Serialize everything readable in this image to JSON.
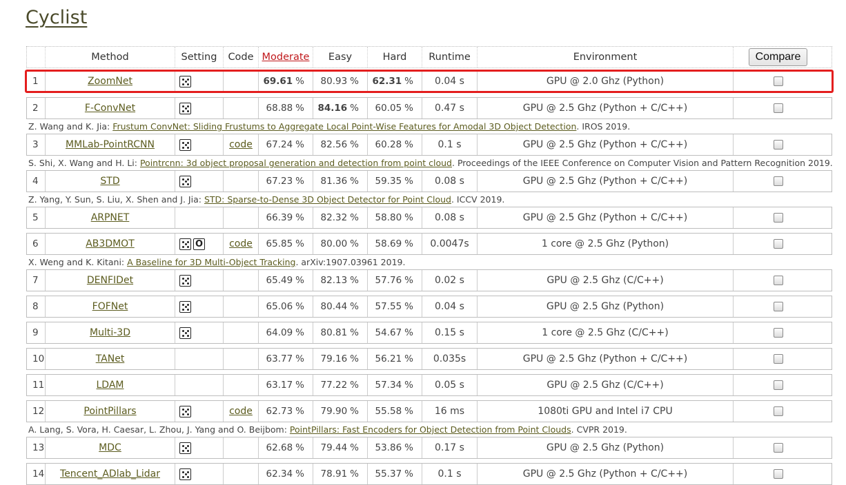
{
  "page": {
    "title": "Cyclist"
  },
  "header": {
    "rank": "",
    "method": "Method",
    "setting": "Setting",
    "code": "Code",
    "moderate": "Moderate",
    "easy": "Easy",
    "hard": "Hard",
    "runtime": "Runtime",
    "environment": "Environment",
    "compare_button": "Compare"
  },
  "rows": [
    {
      "rank": "1",
      "method": "ZoomNet",
      "icons": [
        "dice-icon"
      ],
      "code": "",
      "moderate": "69.61",
      "easy": "80.93",
      "hard": "62.31",
      "runtime": "0.04 s",
      "environment": "GPU @ 2.0 Ghz (Python)",
      "bold": [
        "moderate",
        "hard"
      ],
      "highlight": true,
      "paper": null
    },
    {
      "rank": "2",
      "method": "F-ConvNet",
      "icons": [
        "dice-icon"
      ],
      "code": "",
      "moderate": "68.88",
      "easy": "84.16",
      "hard": "60.05",
      "runtime": "0.47 s",
      "environment": "GPU @ 2.5 Ghz (Python + C/C++)",
      "bold": [
        "easy"
      ],
      "highlight": false,
      "paper": {
        "authors": "Z. Wang and K. Jia: ",
        "title": "Frustum ConvNet: Sliding Frustums to Aggregate Local Point-Wise Features for Amodal 3D Object Detection",
        "venue": ". IROS 2019."
      }
    },
    {
      "rank": "3",
      "method": "MMLab-PointRCNN",
      "icons": [
        "dice-icon"
      ],
      "code": "code",
      "moderate": "67.24",
      "easy": "82.56",
      "hard": "60.28",
      "runtime": "0.1 s",
      "environment": "GPU @ 2.5 Ghz (Python + C/C++)",
      "bold": [],
      "highlight": false,
      "paper": {
        "authors": "S. Shi, X. Wang and H. Li: ",
        "title": "Pointrcnn: 3d object proposal generation and detection from point cloud",
        "venue": ". Proceedings of the IEEE Conference on Computer Vision and Pattern Recognition 2019."
      }
    },
    {
      "rank": "4",
      "method": "STD",
      "icons": [
        "dice-icon"
      ],
      "code": "",
      "moderate": "67.23",
      "easy": "81.36",
      "hard": "59.35",
      "runtime": "0.08 s",
      "environment": "GPU @ 2.5 Ghz (Python + C/C++)",
      "bold": [],
      "highlight": false,
      "paper": {
        "authors": "Z. Yang, Y. Sun, S. Liu, X. Shen and J. Jia: ",
        "title": "STD: Sparse-to-Dense 3D Object Detector for Point Cloud",
        "venue": ". ICCV 2019."
      }
    },
    {
      "rank": "5",
      "method": "ARPNET",
      "icons": [],
      "code": "",
      "moderate": "66.39",
      "easy": "82.32",
      "hard": "58.80",
      "runtime": "0.08 s",
      "environment": "GPU @ 2.5 Ghz (Python + C/C++)",
      "bold": [],
      "highlight": false,
      "paper": null
    },
    {
      "rank": "6",
      "method": "AB3DMOT",
      "icons": [
        "dice-icon",
        "odometry-icon"
      ],
      "code": "code",
      "moderate": "65.85",
      "easy": "80.00",
      "hard": "58.69",
      "runtime": "0.0047s",
      "environment": "1 core @ 2.5 Ghz (Python)",
      "bold": [],
      "highlight": false,
      "paper": {
        "authors": "X. Weng and K. Kitani: ",
        "title": "A Baseline for 3D Multi-Object Tracking",
        "venue": ". arXiv:1907.03961 2019."
      }
    },
    {
      "rank": "7",
      "method": "DENFIDet",
      "icons": [
        "dice-icon"
      ],
      "code": "",
      "moderate": "65.49",
      "easy": "82.13",
      "hard": "57.76",
      "runtime": "0.02 s",
      "environment": "GPU @ 2.5 Ghz (C/C++)",
      "bold": [],
      "highlight": false,
      "paper": null
    },
    {
      "rank": "8",
      "method": "FOFNet",
      "icons": [
        "dice-icon"
      ],
      "code": "",
      "moderate": "65.06",
      "easy": "80.44",
      "hard": "57.55",
      "runtime": "0.04 s",
      "environment": "GPU @ 2.5 Ghz (Python)",
      "bold": [],
      "highlight": false,
      "paper": null
    },
    {
      "rank": "9",
      "method": "Multi-3D",
      "icons": [
        "dice-icon"
      ],
      "code": "",
      "moderate": "64.09",
      "easy": "80.81",
      "hard": "54.67",
      "runtime": "0.15 s",
      "environment": "1 core @ 2.5 Ghz (C/C++)",
      "bold": [],
      "highlight": false,
      "paper": null
    },
    {
      "rank": "10",
      "method": "TANet",
      "icons": [],
      "code": "",
      "moderate": "63.77",
      "easy": "79.16",
      "hard": "56.21",
      "runtime": "0.035s",
      "environment": "GPU @ 2.5 Ghz (Python + C/C++)",
      "bold": [],
      "highlight": false,
      "paper": null
    },
    {
      "rank": "11",
      "method": "LDAM",
      "icons": [],
      "code": "",
      "moderate": "63.17",
      "easy": "77.22",
      "hard": "57.34",
      "runtime": "0.05 s",
      "environment": "GPU @ 2.5 Ghz (C/C++)",
      "bold": [],
      "highlight": false,
      "paper": null
    },
    {
      "rank": "12",
      "method": "PointPillars",
      "icons": [
        "dice-icon"
      ],
      "code": "code",
      "moderate": "62.73",
      "easy": "79.90",
      "hard": "55.58",
      "runtime": "16 ms",
      "environment": "1080ti GPU and Intel i7 CPU",
      "bold": [],
      "highlight": false,
      "paper": {
        "authors": "A. Lang, S. Vora, H. Caesar, L. Zhou, J. Yang and O. Beijbom: ",
        "title": "PointPillars: Fast Encoders for Object Detection from Point Clouds",
        "venue": ". CVPR 2019."
      }
    },
    {
      "rank": "13",
      "method": "MDC",
      "icons": [
        "dice-icon"
      ],
      "code": "",
      "moderate": "62.68",
      "easy": "79.44",
      "hard": "53.86",
      "runtime": "0.17 s",
      "environment": "GPU @ 2.5 Ghz (Python)",
      "bold": [],
      "highlight": false,
      "paper": null
    },
    {
      "rank": "14",
      "method": "Tencent_ADlab_Lidar",
      "icons": [
        "dice-icon"
      ],
      "code": "",
      "moderate": "62.34",
      "easy": "78.91",
      "hard": "55.37",
      "runtime": "0.1 s",
      "environment": "GPU @ 2.5 Ghz (Python + C/C++)",
      "bold": [],
      "highlight": false,
      "paper": null
    }
  ],
  "percent_sign": "%",
  "odometry_glyph": "O",
  "colors": {
    "highlight_border": "#e41e1e",
    "link": "#5c5c1f",
    "sort_link": "#c0181b"
  }
}
